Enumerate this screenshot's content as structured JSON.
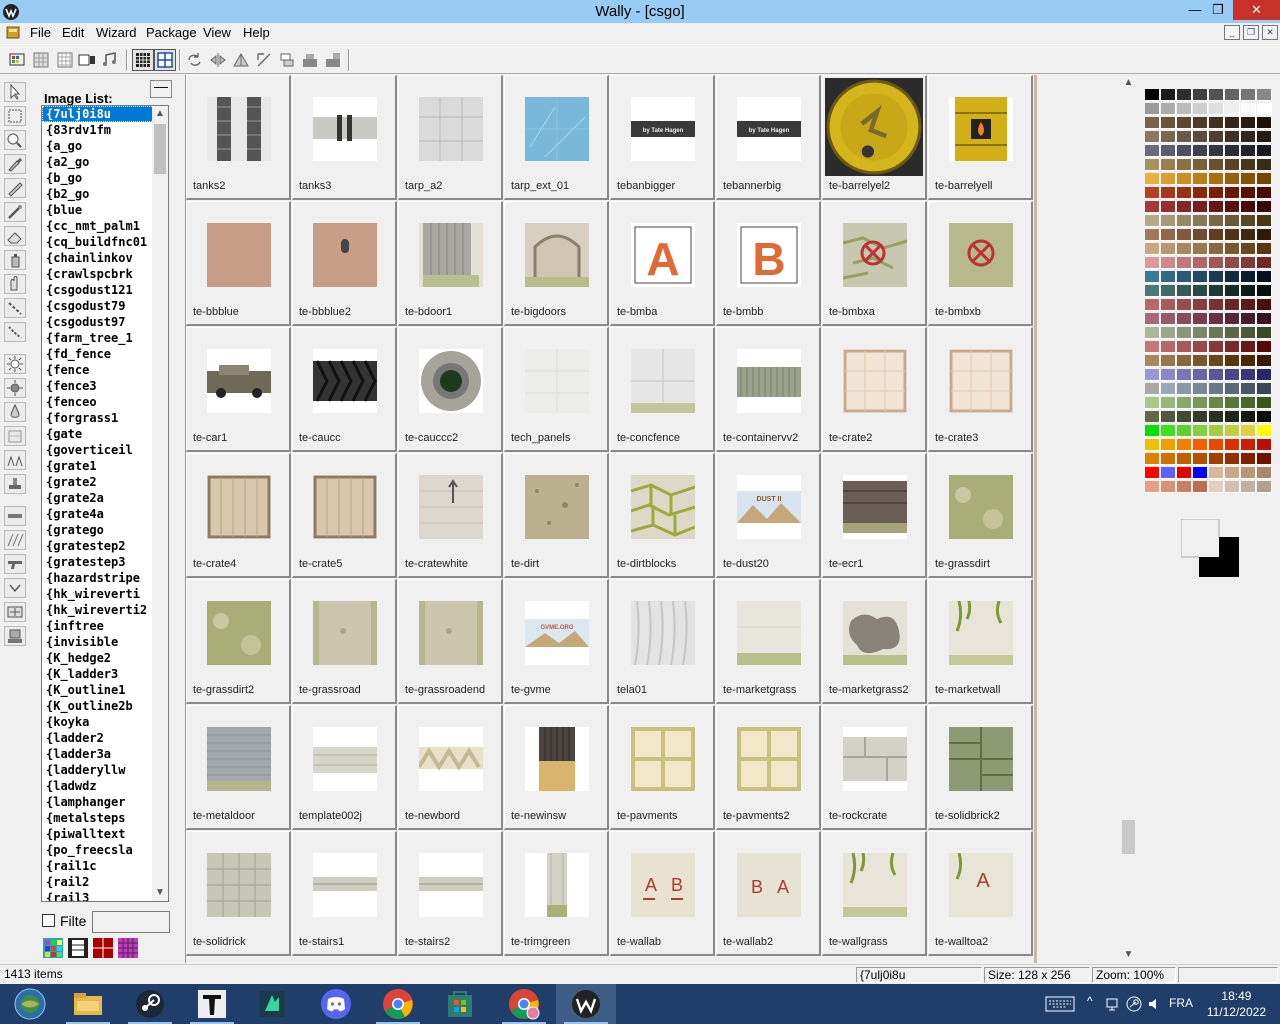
{
  "window": {
    "title": "Wally - [csgo]",
    "min_glyph": "—",
    "max_glyph": "❐",
    "close_glyph": "✕"
  },
  "menu": [
    "File",
    "Edit",
    "Wizard",
    "Package",
    "View",
    "Help"
  ],
  "mdi": {
    "min": "_",
    "restore": "❐",
    "close": "✕"
  },
  "image_list": {
    "label": "Image List:",
    "collapse_glyph": "—",
    "selected": "{7ulj0i8u",
    "items": [
      "{7ulj0i8u",
      "{83rdv1fm",
      "{a_go",
      "{a2_go",
      "{b_go",
      "{b2_go",
      "{blue",
      "{cc_nmt_palm1",
      "{cq_buildfnc01",
      "{chainlinkov",
      "{crawlspcbrk",
      "{csgodust121",
      "{csgodust79",
      "{csgodust97",
      "{farm_tree_1",
      "{fd_fence",
      "{fence",
      "{fence3",
      "{fenceo",
      "{forgrass1",
      "{gate",
      "{goverticeil",
      "{grate1",
      "{grate2",
      "{grate2a",
      "{grate4a",
      "{gratego",
      "{gratestep2",
      "{gratestep3",
      "{hazardstripe",
      "{hk_wireverti",
      "{hk_wireverti2",
      "{inftree",
      "{invisible",
      "{K_hedge2",
      "{K_ladder3",
      "{K_outline1",
      "{K_outline2b",
      "{koyka",
      "{ladder2",
      "{ladder3a",
      "{ladderyllw",
      "{ladwdz",
      "{lamphanger",
      "{metalsteps",
      "{piwalltext",
      "{po_freecsla",
      "{rail1c",
      "{rail2",
      "{rail3"
    ],
    "filter_label": "Filte",
    "filter_value": "",
    "scroll_up": "▲",
    "scroll_down": "▼"
  },
  "thumbnails": [
    {
      "label": "tanks2",
      "icon": "tank-metal-texture"
    },
    {
      "label": "tanks3",
      "icon": "tank-strip-texture"
    },
    {
      "label": "tarp_a2",
      "icon": "grey-tarp-texture"
    },
    {
      "label": "tarp_ext_01",
      "icon": "blue-tarp-texture"
    },
    {
      "label": "tebanbigger",
      "icon": "banner-sign-texture",
      "text": "by Tate Hagen"
    },
    {
      "label": "tebannerbig",
      "icon": "banner-sign-texture",
      "text": "by Tate Hagen"
    },
    {
      "label": "te-barrelyel2",
      "icon": "yellow-barrel-top-texture"
    },
    {
      "label": "te-barrelyell",
      "icon": "yellow-barrel-side-texture"
    },
    {
      "label": "te-bbblue",
      "icon": "plaster-wall-texture"
    },
    {
      "label": "te-bbblue2",
      "icon": "plaster-window-texture"
    },
    {
      "label": "te-bdoor1",
      "icon": "wooden-door-texture"
    },
    {
      "label": "te-bigdoors",
      "icon": "arch-doors-texture"
    },
    {
      "label": "te-bmba",
      "icon": "bombsite-a-texture",
      "text": "A"
    },
    {
      "label": "te-bmbb",
      "icon": "bombsite-b-texture",
      "text": "B"
    },
    {
      "label": "te-bmbxa",
      "icon": "bomb-decal-stone-texture"
    },
    {
      "label": "te-bmbxb",
      "icon": "bomb-decal-grass-texture"
    },
    {
      "label": "te-car1",
      "icon": "car-texture"
    },
    {
      "label": "te-caucc",
      "icon": "tire-tread-texture"
    },
    {
      "label": "te-cauccc2",
      "icon": "tire-side-texture"
    },
    {
      "label": "tech_panels",
      "icon": "tech-panels-texture"
    },
    {
      "label": "te-concfence",
      "icon": "concrete-fence-texture"
    },
    {
      "label": "te-containervv2",
      "icon": "container-texture"
    },
    {
      "label": "te-crate2",
      "icon": "light-crate-texture"
    },
    {
      "label": "te-crate3",
      "icon": "light-crate-texture"
    },
    {
      "label": "te-crate4",
      "icon": "wood-crate-texture"
    },
    {
      "label": "te-crate5",
      "icon": "wood-crate-texture"
    },
    {
      "label": "te-cratewhite",
      "icon": "white-crate-texture"
    },
    {
      "label": "te-dirt",
      "icon": "dirt-texture"
    },
    {
      "label": "te-dirtblocks",
      "icon": "mossy-blocks-texture"
    },
    {
      "label": "te-dust20",
      "icon": "dust-poster-texture",
      "text": "DUST II"
    },
    {
      "label": "te-ecr1",
      "icon": "metal-rail-texture"
    },
    {
      "label": "te-grassdirt",
      "icon": "grass-dirt-texture"
    },
    {
      "label": "te-grassdirt2",
      "icon": "grass-dirt-texture"
    },
    {
      "label": "te-grassroad",
      "icon": "grass-road-texture"
    },
    {
      "label": "te-grassroadend",
      "icon": "grass-road-texture"
    },
    {
      "label": "te-gvme",
      "icon": "poster-texture",
      "text": "GVME.ORG"
    },
    {
      "label": "tela01",
      "icon": "curtain-texture"
    },
    {
      "label": "te-marketgrass",
      "icon": "market-grass-texture"
    },
    {
      "label": "te-marketgrass2",
      "icon": "market-patch-texture"
    },
    {
      "label": "te-marketwall",
      "icon": "vine-wall-texture"
    },
    {
      "label": "te-metaldoor",
      "icon": "metal-door-texture"
    },
    {
      "label": "template002j",
      "icon": "wall-strip-texture"
    },
    {
      "label": "te-newbord",
      "icon": "chevron-strip-texture"
    },
    {
      "label": "te-newinsw",
      "icon": "dark-panel-texture"
    },
    {
      "label": "te-pavments",
      "icon": "pavement-texture"
    },
    {
      "label": "te-pavments2",
      "icon": "pavement-texture"
    },
    {
      "label": "te-rockcrate",
      "icon": "rock-crate-texture"
    },
    {
      "label": "te-solidbrick2",
      "icon": "green-brick-texture"
    },
    {
      "label": "te-solidrick",
      "icon": "stone-tile-texture"
    },
    {
      "label": "te-stairs1",
      "icon": "stair-strip-texture"
    },
    {
      "label": "te-stairs2",
      "icon": "stair-strip-texture"
    },
    {
      "label": "te-trimgreen",
      "icon": "trim-column-texture"
    },
    {
      "label": "te-wallab",
      "icon": "wall-ab-texture",
      "text": "A B"
    },
    {
      "label": "te-wallab2",
      "icon": "wall-ba-texture",
      "text": "B A"
    },
    {
      "label": "te-wallgrass",
      "icon": "vine-wall-texture"
    },
    {
      "label": "te-walltoa2",
      "icon": "wall-a-texture",
      "text": "A"
    }
  ],
  "status": {
    "count": "1413 items",
    "selected": "{7ulj0i8u",
    "size": "Size: 128 x 256",
    "zoom": "Zoom: 100%"
  },
  "taskbar": {
    "apps": [
      "start-orb-icon",
      "file-explorer-icon",
      "steam-icon",
      "counter-strike-icon",
      "app-icon",
      "discord-icon",
      "chrome-icon",
      "store-icon",
      "chrome-profile-icon",
      "wally-icon"
    ],
    "lang": "FRA",
    "time": "18:49",
    "date": "11/12/2022"
  },
  "colors": {
    "titlebar": "#99ccf4",
    "close": "#c7312a",
    "selection": "#0078d7",
    "taskbar": "#1f3e6a"
  }
}
